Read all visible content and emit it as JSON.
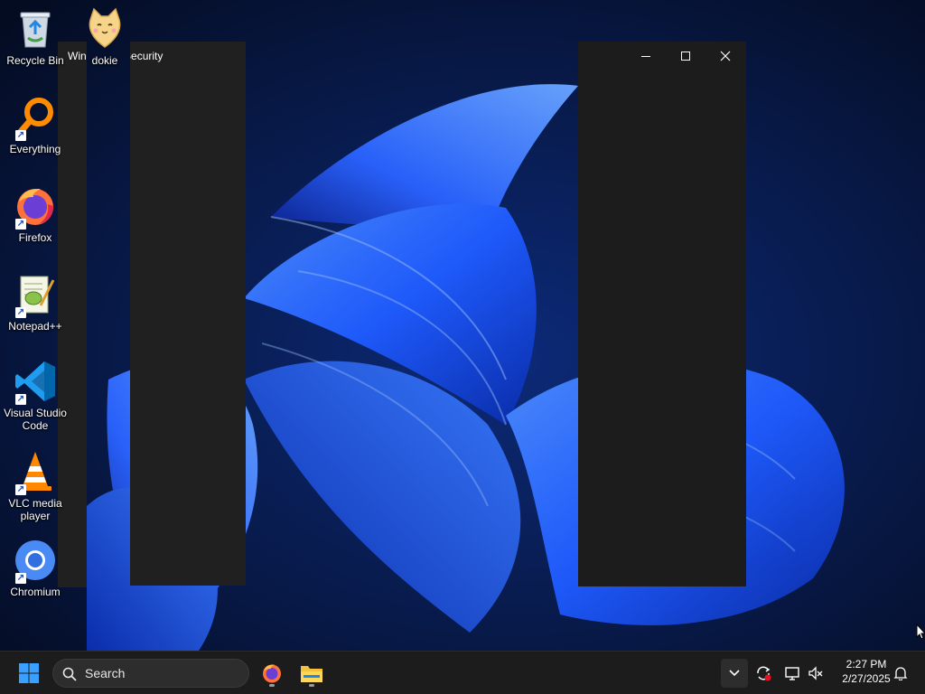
{
  "desktop": {
    "icons": [
      {
        "label": "Recycle Bin",
        "icon": "recycle-bin-icon"
      },
      {
        "label": "dokie",
        "icon": "cat-app-icon"
      },
      {
        "label": "Everything",
        "icon": "magnifier-orange-icon"
      },
      {
        "label": "Firefox",
        "icon": "firefox-icon"
      },
      {
        "label": "Notepad++",
        "icon": "notepad-plus-icon"
      },
      {
        "label": "Visual Studio Code",
        "icon": "vscode-icon"
      },
      {
        "label": "VLC media player",
        "icon": "vlc-cone-icon"
      },
      {
        "label": "Chromium",
        "icon": "chromium-icon"
      }
    ]
  },
  "window": {
    "title": "Windows Security",
    "minimize_glyph": "—",
    "maximize_glyph": "□",
    "close_glyph": "✕"
  },
  "taskbar": {
    "start_icon": "windows-start-icon",
    "search_placeholder": "Search",
    "pinned": [
      {
        "name": "Firefox",
        "icon": "firefox-icon",
        "running": true
      },
      {
        "name": "File Explorer",
        "icon": "folder-icon",
        "running": true
      }
    ],
    "tray": {
      "overflow_icon": "chevron-up-icon",
      "icons": [
        "sync-alert-icon",
        "display-network-icon",
        "volume-muted-icon"
      ]
    },
    "clock": {
      "time": "2:27 PM",
      "date": "2/27/2025"
    },
    "notification_icon": "bell-icon"
  },
  "colors": {
    "accent": "#0067c0",
    "taskbar": "#1c1c1c",
    "window_dark": "#202020",
    "wallpaper_bg": "#06122b",
    "bloom_blue": "#1f5bff"
  }
}
